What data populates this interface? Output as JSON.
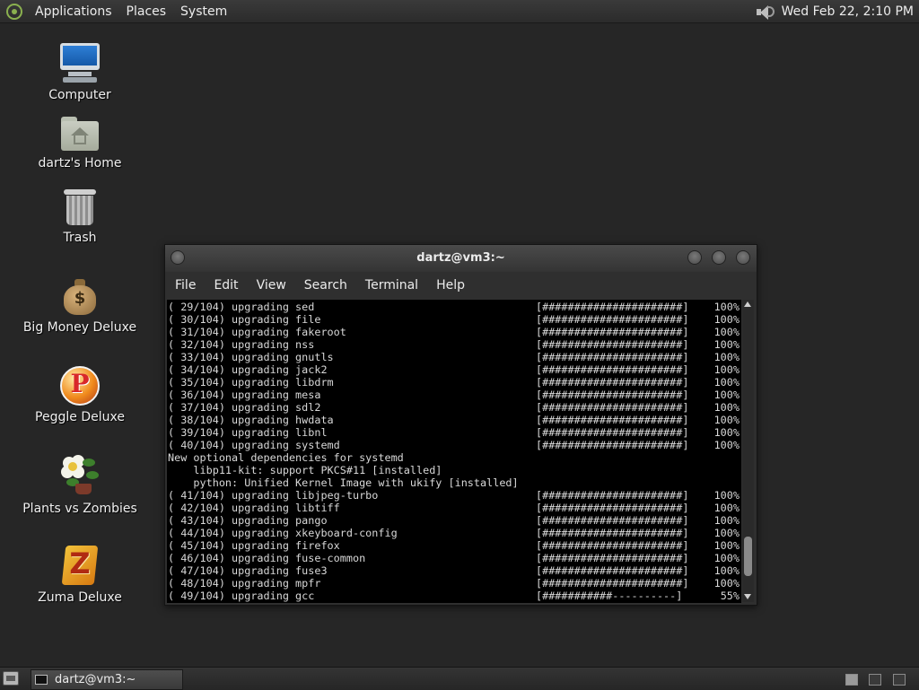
{
  "top_panel": {
    "menus": [
      "Applications",
      "Places",
      "System"
    ],
    "clock": "Wed Feb 22,  2:10 PM"
  },
  "desktop": {
    "icons": [
      {
        "label": "Computer",
        "icon": "computer-icon"
      },
      {
        "label": "dartz's Home",
        "icon": "home-folder-icon"
      },
      {
        "label": "Trash",
        "icon": "trash-icon"
      },
      {
        "label": "Big Money Deluxe",
        "icon": "money-bag-icon"
      },
      {
        "label": "Peggle Deluxe",
        "icon": "peggle-icon"
      },
      {
        "label": "Plants vs Zombies",
        "icon": "plants-vs-zombies-icon"
      },
      {
        "label": "Zuma Deluxe",
        "icon": "zuma-icon"
      }
    ]
  },
  "terminal_window": {
    "title": "dartz@vm3:~",
    "menu": [
      "File",
      "Edit",
      "View",
      "Search",
      "Terminal",
      "Help"
    ],
    "lines": [
      {
        "text": "( 29/104) upgrading sed",
        "bar": "[######################]",
        "pct": "100%"
      },
      {
        "text": "( 30/104) upgrading file",
        "bar": "[######################]",
        "pct": "100%"
      },
      {
        "text": "( 31/104) upgrading fakeroot",
        "bar": "[######################]",
        "pct": "100%"
      },
      {
        "text": "( 32/104) upgrading nss",
        "bar": "[######################]",
        "pct": "100%"
      },
      {
        "text": "( 33/104) upgrading gnutls",
        "bar": "[######################]",
        "pct": "100%"
      },
      {
        "text": "( 34/104) upgrading jack2",
        "bar": "[######################]",
        "pct": "100%"
      },
      {
        "text": "( 35/104) upgrading libdrm",
        "bar": "[######################]",
        "pct": "100%"
      },
      {
        "text": "( 36/104) upgrading mesa",
        "bar": "[######################]",
        "pct": "100%"
      },
      {
        "text": "( 37/104) upgrading sdl2",
        "bar": "[######################]",
        "pct": "100%"
      },
      {
        "text": "( 38/104) upgrading hwdata",
        "bar": "[######################]",
        "pct": "100%"
      },
      {
        "text": "( 39/104) upgrading libnl",
        "bar": "[######################]",
        "pct": "100%"
      },
      {
        "text": "( 40/104) upgrading systemd",
        "bar": "[######################]",
        "pct": "100%"
      },
      {
        "text": "New optional dependencies for systemd",
        "bar": "",
        "pct": ""
      },
      {
        "text": "    libp11-kit: support PKCS#11 [installed]",
        "bar": "",
        "pct": ""
      },
      {
        "text": "    python: Unified Kernel Image with ukify [installed]",
        "bar": "",
        "pct": ""
      },
      {
        "text": "( 41/104) upgrading libjpeg-turbo",
        "bar": "[######################]",
        "pct": "100%"
      },
      {
        "text": "( 42/104) upgrading libtiff",
        "bar": "[######################]",
        "pct": "100%"
      },
      {
        "text": "( 43/104) upgrading pango",
        "bar": "[######################]",
        "pct": "100%"
      },
      {
        "text": "( 44/104) upgrading xkeyboard-config",
        "bar": "[######################]",
        "pct": "100%"
      },
      {
        "text": "( 45/104) upgrading firefox",
        "bar": "[######################]",
        "pct": "100%"
      },
      {
        "text": "( 46/104) upgrading fuse-common",
        "bar": "[######################]",
        "pct": "100%"
      },
      {
        "text": "( 47/104) upgrading fuse3",
        "bar": "[######################]",
        "pct": "100%"
      },
      {
        "text": "( 48/104) upgrading mpfr",
        "bar": "[######################]",
        "pct": "100%"
      },
      {
        "text": "( 49/104) upgrading gcc",
        "bar": "[###########----------]",
        "pct": "55%"
      }
    ],
    "scroll_position": 0.95
  },
  "bottom_panel": {
    "tasks": [
      {
        "label": "dartz@vm3:~",
        "icon": "terminal-icon"
      }
    ],
    "workspaces": 3,
    "active_workspace": 1
  }
}
